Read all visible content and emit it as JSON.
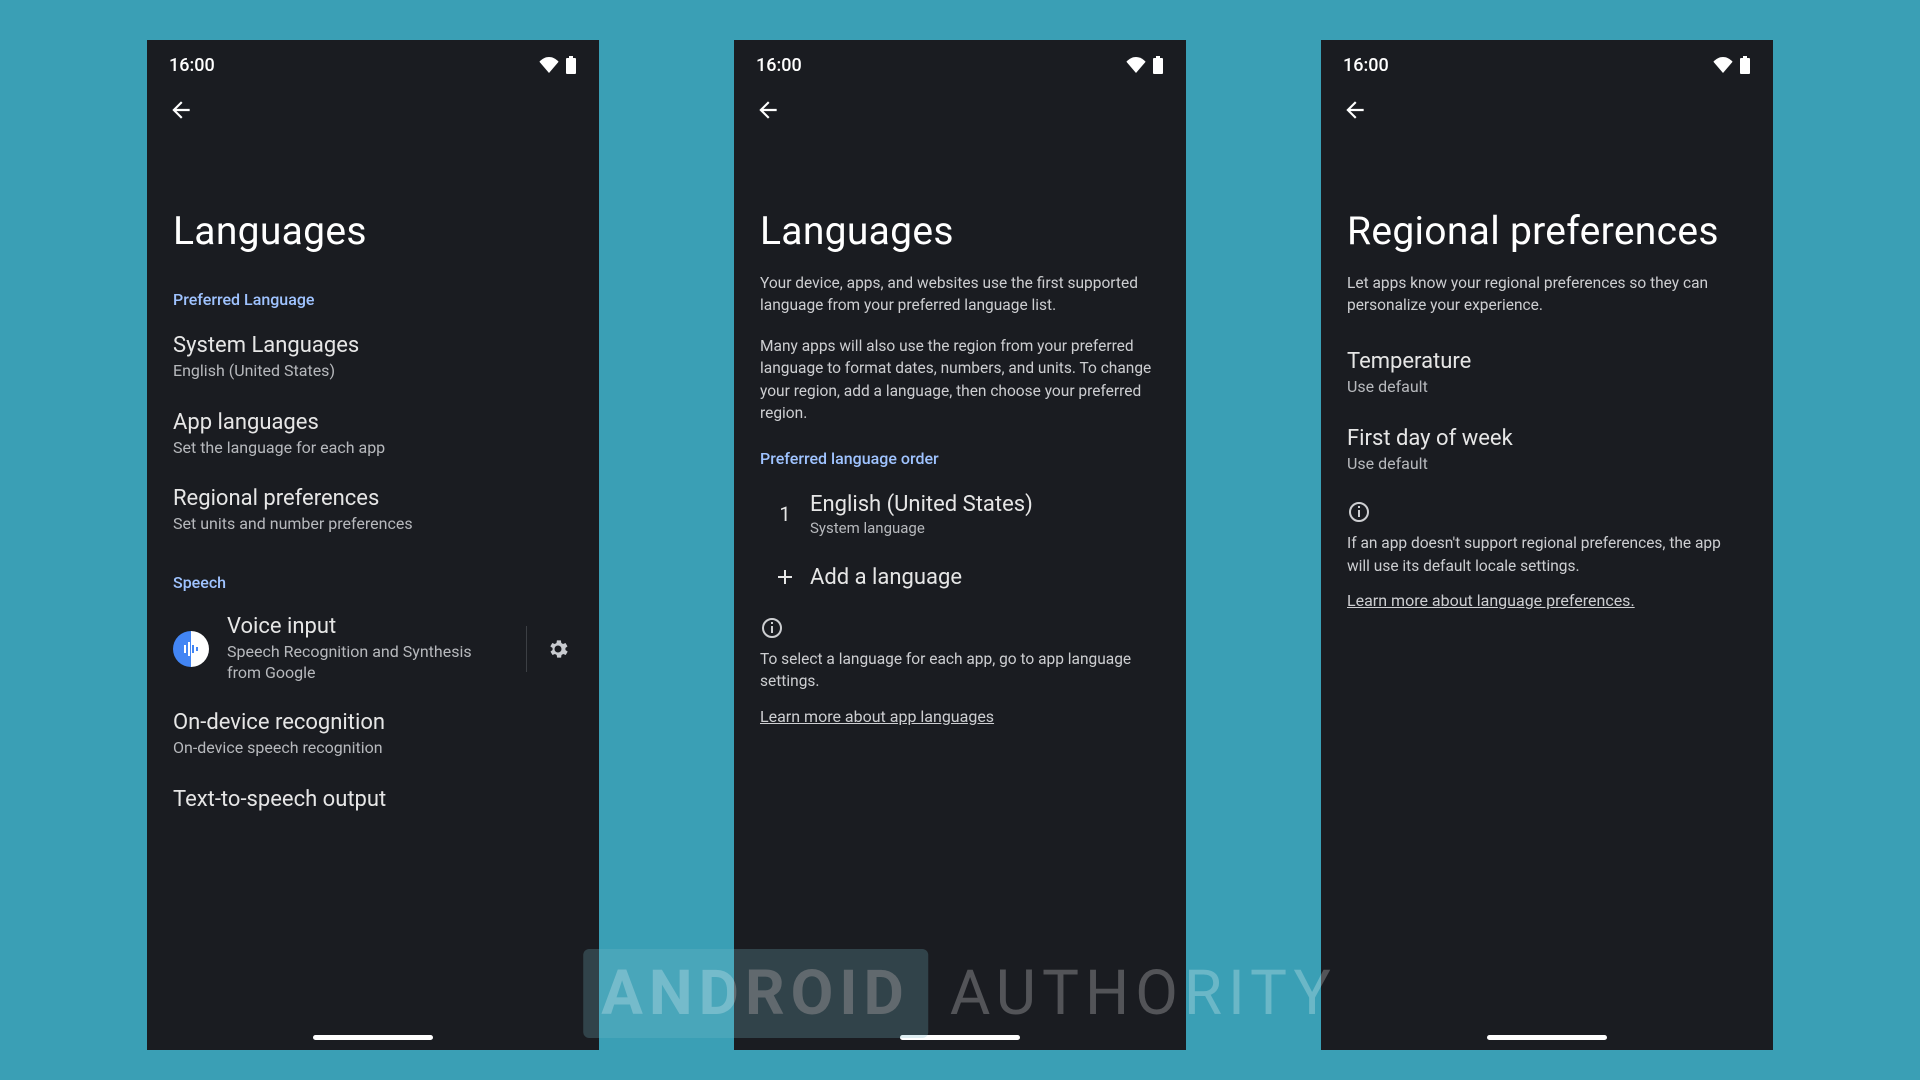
{
  "status": {
    "time": "16:00"
  },
  "screen1": {
    "title": "Languages",
    "section_preferred": "Preferred Language",
    "system_languages": {
      "title": "System Languages",
      "sub": "English (United States)"
    },
    "app_languages": {
      "title": "App languages",
      "sub": "Set the language for each app"
    },
    "regional_prefs": {
      "title": "Regional preferences",
      "sub": "Set units and number preferences"
    },
    "section_speech": "Speech",
    "voice_input": {
      "title": "Voice input",
      "sub": "Speech Recognition and Synthesis from Google"
    },
    "on_device": {
      "title": "On-device recognition",
      "sub": "On-device speech recognition"
    },
    "tts": {
      "title": "Text-to-speech output"
    }
  },
  "screen2": {
    "title": "Languages",
    "intro1": "Your device, apps, and websites use the first supported language from your preferred language list.",
    "intro2": "Many apps will also use the region from your preferred language to format dates, numbers, and units. To change your region, add a language, then choose your preferred region.",
    "section_order": "Preferred language order",
    "lang1": {
      "num": "1",
      "title": "English (United States)",
      "sub": "System language"
    },
    "add_language": "Add a language",
    "info_text": "To select a language for each app, go to app language settings.",
    "learn_more": "Learn more about app languages"
  },
  "screen3": {
    "title": "Regional preferences",
    "intro": "Let apps know your regional preferences so they can personalize your experience.",
    "temperature": {
      "title": "Temperature",
      "sub": "Use default"
    },
    "first_day": {
      "title": "First day of week",
      "sub": "Use default"
    },
    "info_text": "If an app doesn't support regional preferences, the app will use its default locale settings.",
    "learn_more": "Learn more about language preferences."
  },
  "watermark": {
    "left": "ANDROID",
    "right": "AUTHORITY"
  }
}
